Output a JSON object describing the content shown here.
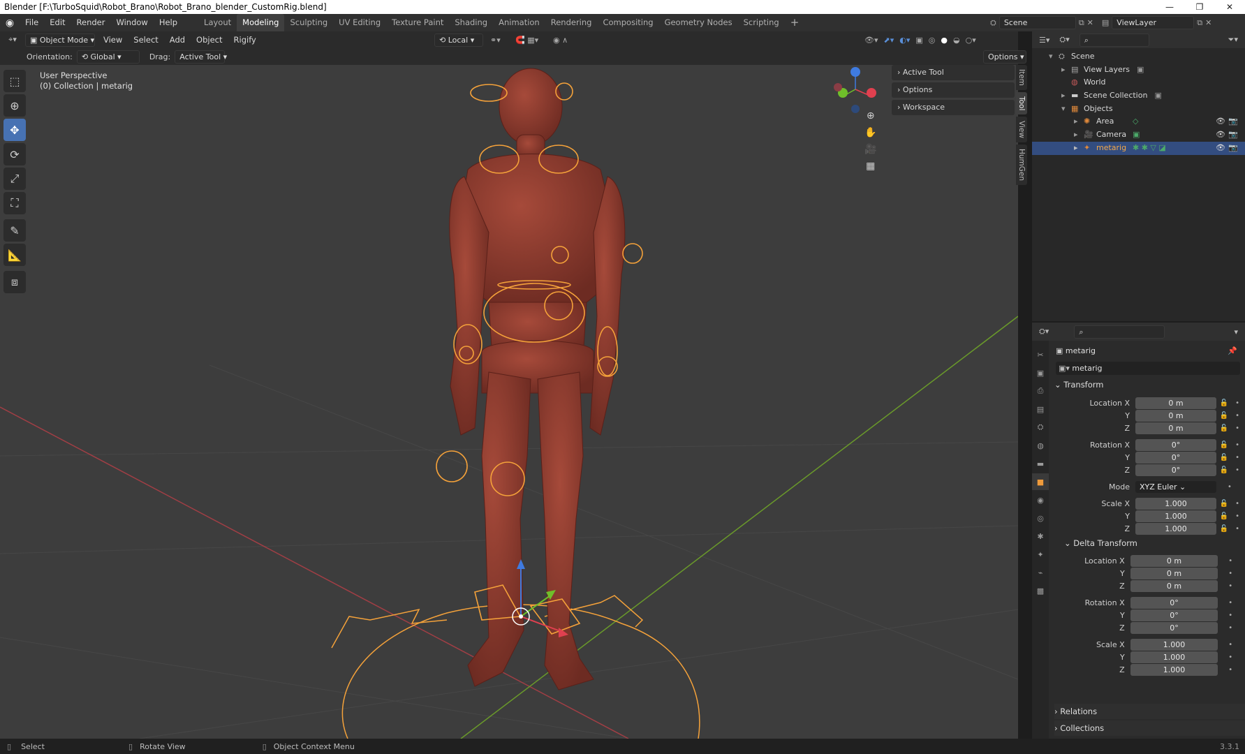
{
  "window": {
    "title": "Blender [F:\\TurboSquid\\Robot_Brano\\Robot_Brano_blender_CustomRig.blend]",
    "min": "—",
    "max": "❐",
    "close": "✕"
  },
  "menus": [
    "File",
    "Edit",
    "Render",
    "Window",
    "Help"
  ],
  "workspaces": [
    "Layout",
    "Modeling",
    "Sculpting",
    "UV Editing",
    "Texture Paint",
    "Shading",
    "Animation",
    "Rendering",
    "Compositing",
    "Geometry Nodes",
    "Scripting"
  ],
  "active_workspace": "Modeling",
  "scene": {
    "scene_name": "Scene",
    "view_layer": "ViewLayer"
  },
  "viewport_header": {
    "mode": "Object Mode",
    "menus": [
      "View",
      "Select",
      "Add",
      "Object",
      "Rigify"
    ],
    "transform_orientation": "Local"
  },
  "tool_settings": {
    "orientation_label": "Orientation:",
    "orientation_value": "Global",
    "drag_label": "Drag:",
    "drag_value": "Active Tool",
    "options": "Options"
  },
  "viewport_info": {
    "perspective": "User Perspective",
    "collection": "(0) Collection | metarig"
  },
  "npanel": {
    "sections": [
      "Active Tool",
      "Options",
      "Workspace"
    ],
    "tabs": [
      "Item",
      "Tool",
      "View",
      "HumGen"
    ],
    "active_tab": "Tool"
  },
  "outliner": {
    "items": [
      {
        "label": "Scene",
        "depth": 0
      },
      {
        "label": "View Layers",
        "depth": 1
      },
      {
        "label": "World",
        "depth": 1
      },
      {
        "label": "Scene Collection",
        "depth": 1
      },
      {
        "label": "Objects",
        "depth": 1
      },
      {
        "label": "Area",
        "depth": 2
      },
      {
        "label": "Camera",
        "depth": 2
      },
      {
        "label": "metarig",
        "depth": 2,
        "selected": true
      }
    ]
  },
  "properties": {
    "object_name": "metarig",
    "data_name": "metarig",
    "transform_title": "Transform",
    "location": {
      "label": "Location X",
      "x": "0 m",
      "y": "0 m",
      "z": "0 m"
    },
    "rotation": {
      "label": "Rotation X",
      "x": "0°",
      "y": "0°",
      "z": "0°"
    },
    "mode": {
      "label": "Mode",
      "value": "XYZ Euler"
    },
    "scale": {
      "label": "Scale X",
      "x": "1.000",
      "y": "1.000",
      "z": "1.000"
    },
    "delta_title": "Delta Transform",
    "delta_location": {
      "x": "0 m",
      "y": "0 m",
      "z": "0 m"
    },
    "delta_rotation": {
      "x": "0°",
      "y": "0°",
      "z": "0°"
    },
    "delta_scale": {
      "x": "1.000",
      "y": "1.000",
      "z": "1.000"
    },
    "axis_y": "Y",
    "axis_z": "Z",
    "relations": "Relations",
    "collections": "Collections"
  },
  "statusbar": {
    "select": "Select",
    "rotate": "Rotate View",
    "context": "Object Context Menu",
    "version": "3.3.1"
  },
  "colors": {
    "accent": "#4772b3",
    "orange": "#f5a23a",
    "robot": "#8a3a2e",
    "selected_row": "#334d80"
  }
}
